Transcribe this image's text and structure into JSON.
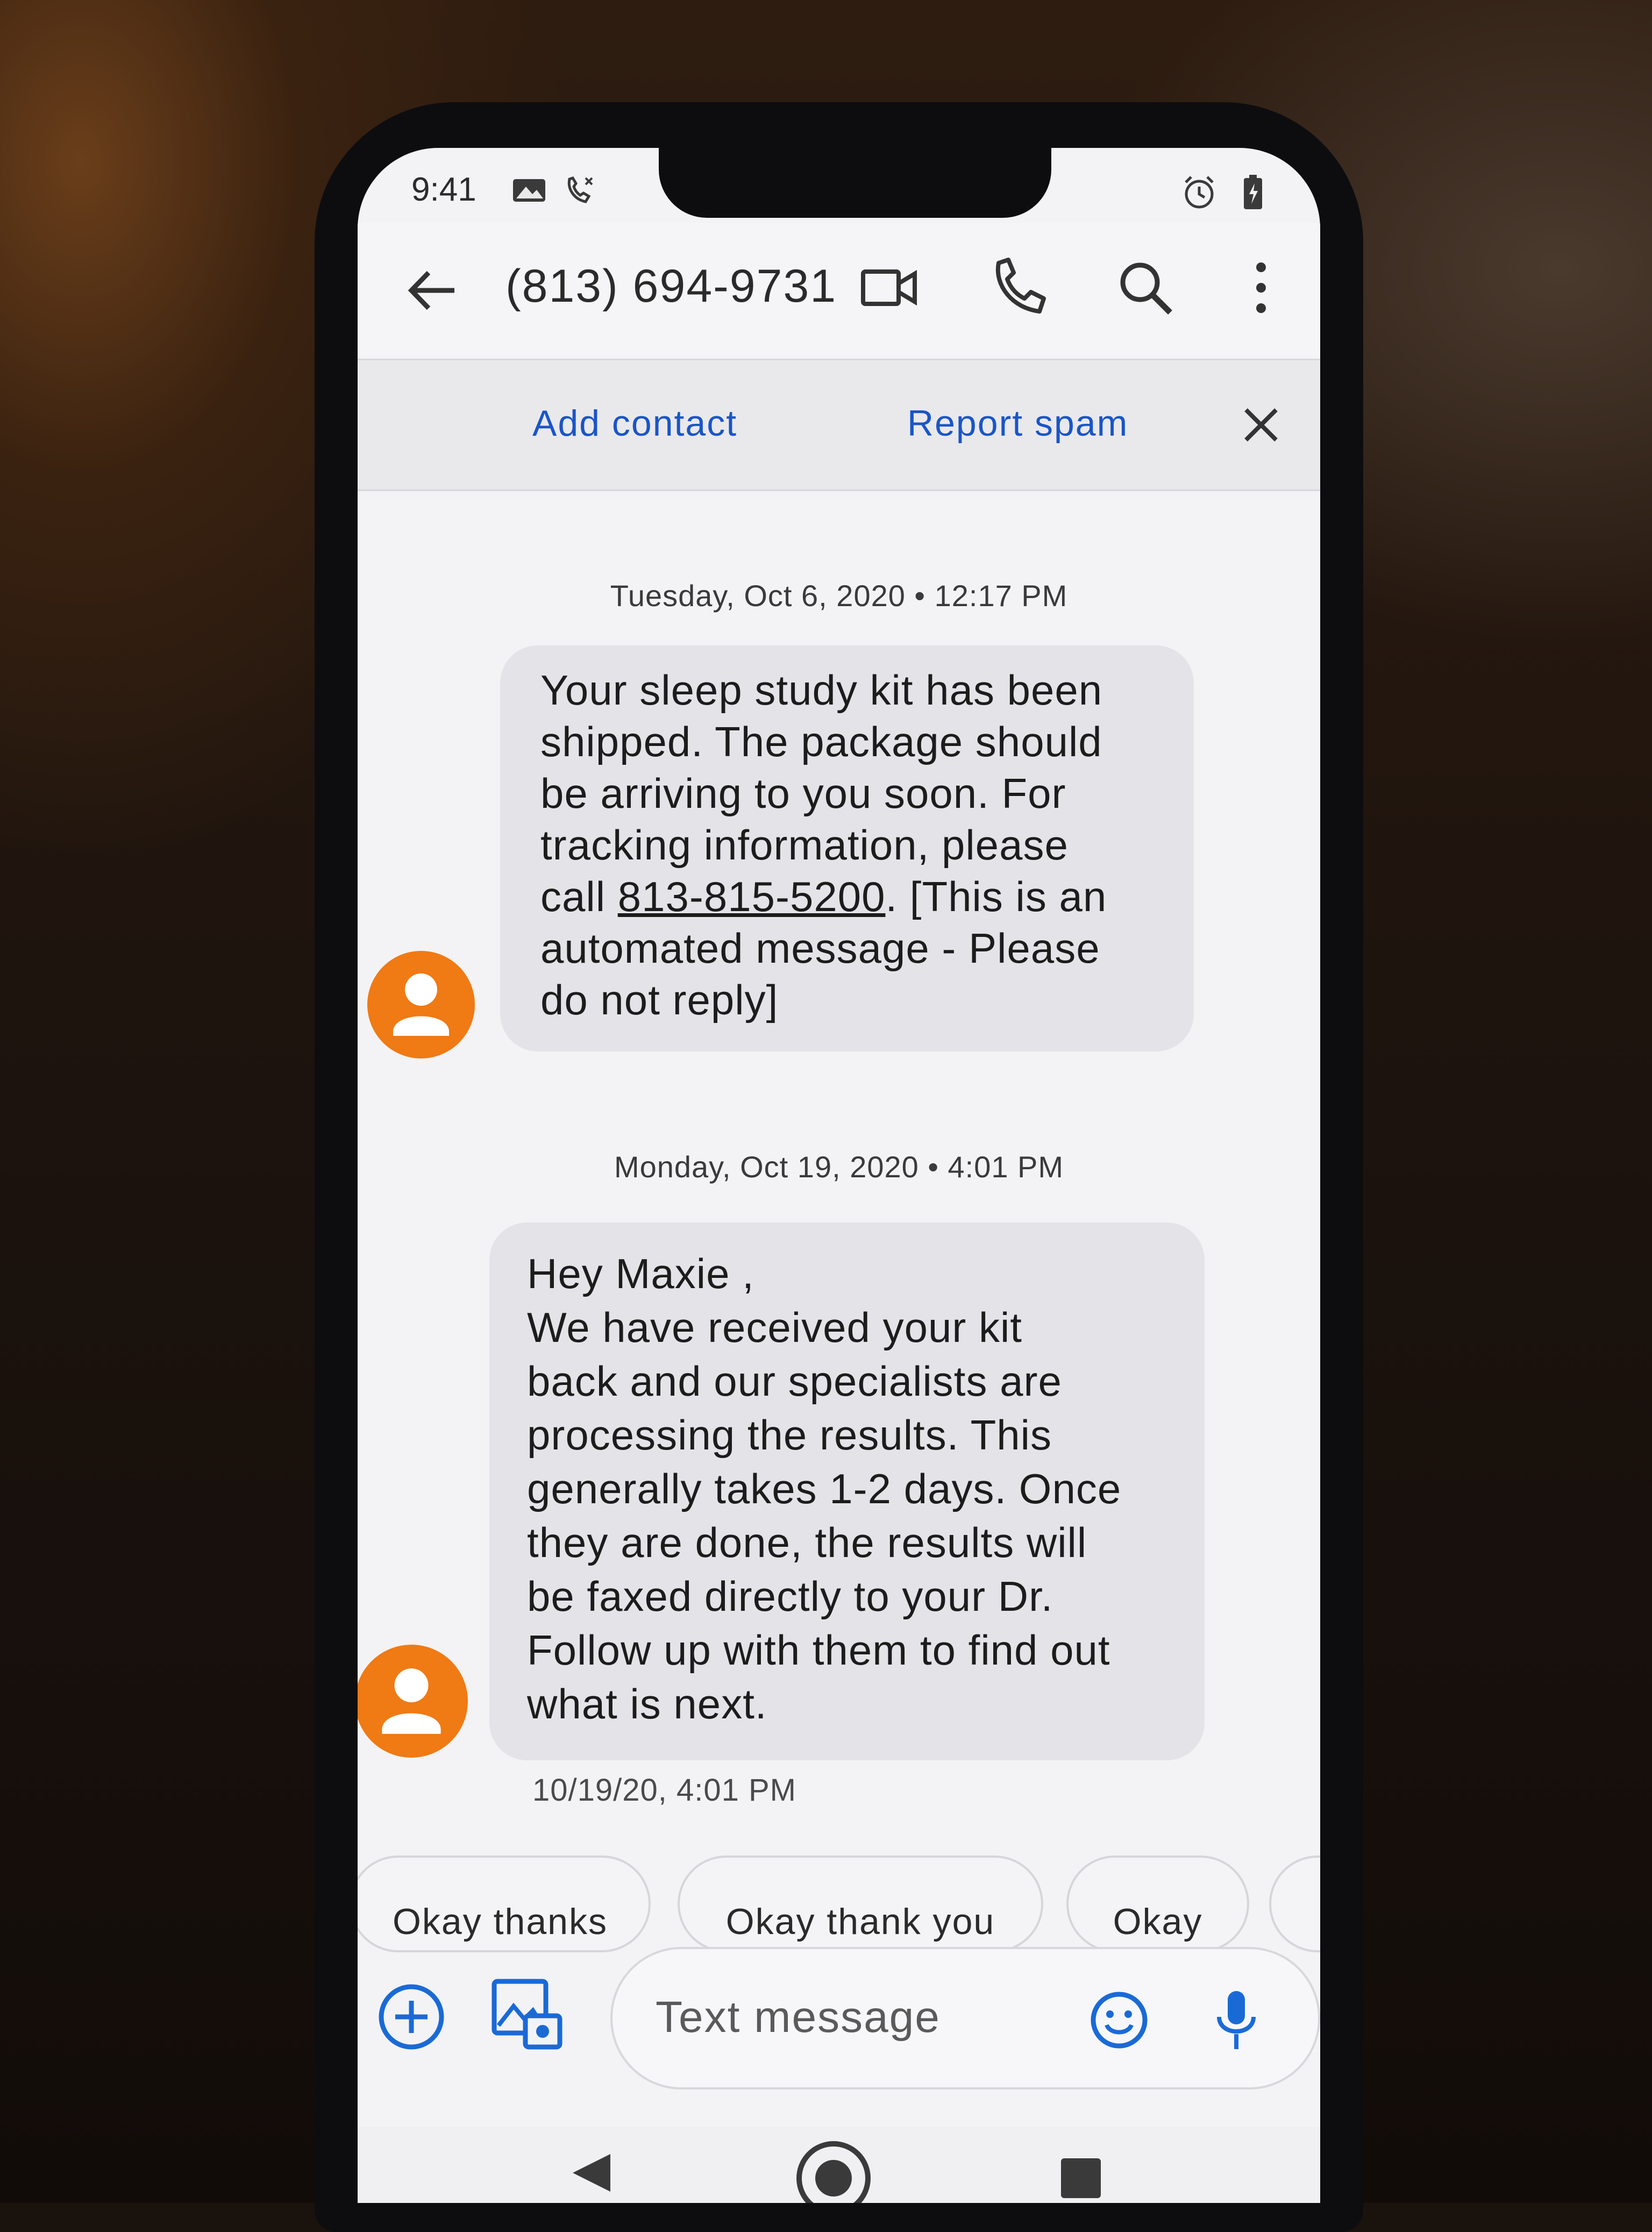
{
  "status_bar": {
    "time": "9:41",
    "icons": [
      "gallery-notification-icon",
      "missed-call-icon",
      "alarm-icon",
      "battery-icon"
    ]
  },
  "app_bar": {
    "title": "(813) 694-9731",
    "icons": [
      "back-arrow-icon",
      "video-call-icon",
      "phone-icon",
      "search-icon",
      "more-options-icon"
    ]
  },
  "spam_banner": {
    "add_contact": "Add contact",
    "report_spam": "Report spam",
    "close_icon": "close-icon"
  },
  "conversation": {
    "messages": [
      {
        "date_header": "Tuesday, Oct 6, 2020 • 12:17 PM",
        "lines": [
          "Your sleep study kit has been",
          "shipped. The package should",
          "be arriving to you soon. For",
          "tracking information, please"
        ],
        "line5_prefix": "call ",
        "line5_link": "813-815-5200",
        "line5_suffix": ".  [This is an",
        "lines_end": [
          "automated message - Please",
          "do not reply]"
        ]
      },
      {
        "date_header": "Monday, Oct 19, 2020 • 4:01 PM",
        "lines": [
          "Hey Maxie ,",
          "We have received your kit",
          "back and our specialists are",
          "processing the results. This",
          "generally takes 1-2 days. Once",
          "they are done, the results will",
          "be faxed directly to your Dr.",
          "Follow up with them to find out",
          "what is next."
        ],
        "sent_time": "10/19/20, 4:01 PM"
      }
    ]
  },
  "smart_replies": [
    "Okay thanks",
    "Okay thank you",
    "Okay"
  ],
  "compose": {
    "placeholder": "Text message",
    "icons": [
      "add-icon",
      "gallery-icon",
      "emoji-icon",
      "microphone-icon"
    ]
  },
  "nav_bar": {
    "icons": [
      "back-nav-icon",
      "home-nav-icon",
      "recents-nav-icon"
    ]
  },
  "colors": {
    "link_blue": "#1a55c8",
    "avatar_orange": "#f07a14",
    "bubble_gray": "#e4e4e8"
  }
}
